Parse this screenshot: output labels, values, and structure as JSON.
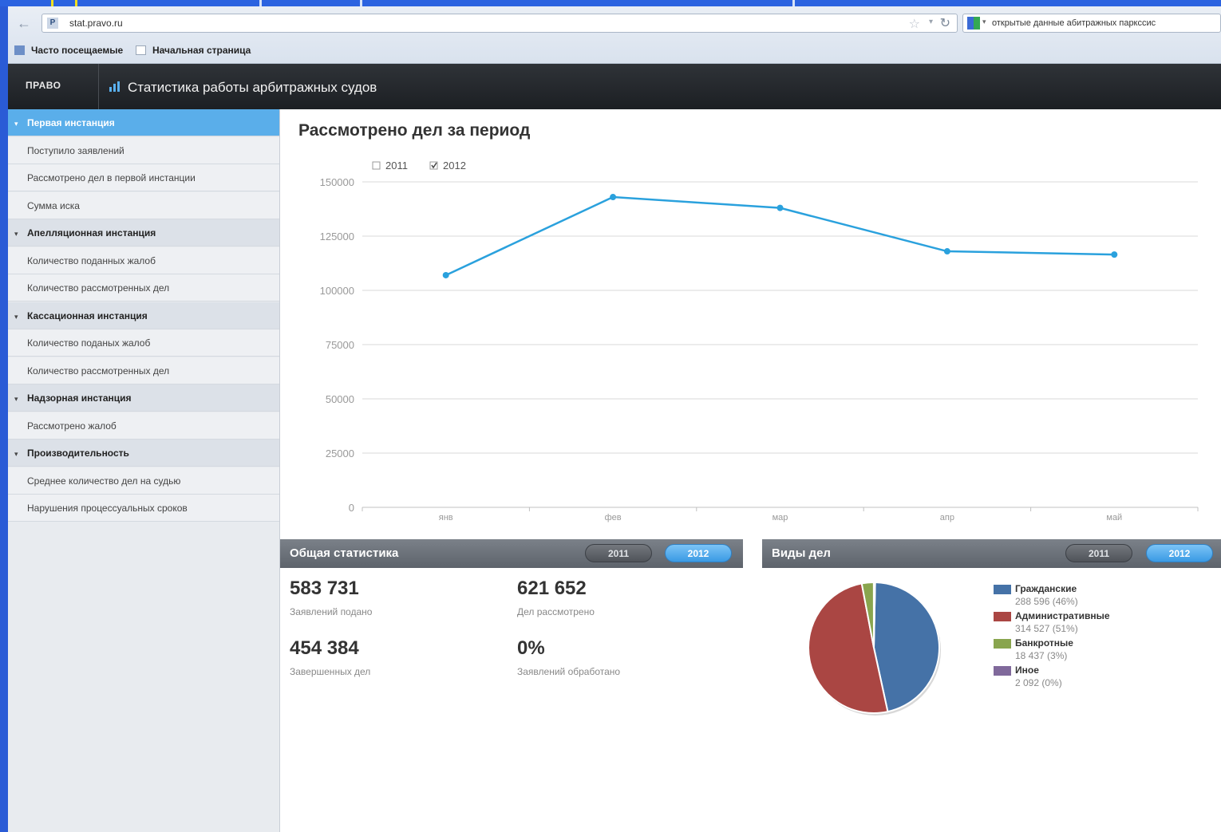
{
  "browser": {
    "url": "stat.pravo.ru",
    "search_text": "открытые данные абитражных паркссис",
    "bookmarks": [
      "Часто посещаемые",
      "Начальная страница"
    ]
  },
  "app": {
    "logo_text": "ПРАВО",
    "title": "Статистика работы арбитражных судов"
  },
  "sidebar": {
    "items": [
      {
        "label": "Первая инстанция",
        "type": "head",
        "active": true
      },
      {
        "label": "Поступило заявлений",
        "type": "sub"
      },
      {
        "label": "Рассмотрено дел в первой инстанции",
        "type": "sub"
      },
      {
        "label": "Сумма иска",
        "type": "sub"
      },
      {
        "label": "Апелляционная инстанция",
        "type": "head"
      },
      {
        "label": "Количество поданных жалоб",
        "type": "sub"
      },
      {
        "label": "Количество рассмотренных дел",
        "type": "sub"
      },
      {
        "label": "Кассационная инстанция",
        "type": "head"
      },
      {
        "label": "Количество поданых жалоб",
        "type": "sub"
      },
      {
        "label": "Количество рассмотренных дел",
        "type": "sub"
      },
      {
        "label": "Надзорная инстанция",
        "type": "head"
      },
      {
        "label": "Рассмотрено жалоб",
        "type": "sub"
      },
      {
        "label": "Производительность",
        "type": "head"
      },
      {
        "label": "Среднее количество дел на судью",
        "type": "sub"
      },
      {
        "label": "Нарушения процессуальных сроков",
        "type": "sub"
      }
    ]
  },
  "main": {
    "chart_title": "Рассмотрено дел за период"
  },
  "chart_data": {
    "type": "line",
    "title": "Рассмотрено дел за период",
    "xlabel": "",
    "ylabel": "",
    "categories": [
      "янв",
      "фев",
      "мар",
      "апр",
      "май"
    ],
    "legend": [
      {
        "label": "2011",
        "checked": false
      },
      {
        "label": "2012",
        "checked": true
      }
    ],
    "series": [
      {
        "name": "2012",
        "values": [
          107000,
          143000,
          138000,
          118000,
          116500
        ]
      }
    ],
    "ylim": [
      0,
      150000
    ],
    "yticks": [
      0,
      25000,
      50000,
      75000,
      100000,
      125000,
      150000
    ],
    "grid": true,
    "line_color": "#2aa1dd"
  },
  "general_stats": {
    "title": "Общая статистика",
    "years": [
      "2011",
      "2012"
    ],
    "active_year": "2012",
    "items": [
      {
        "value": "583 731",
        "label": "Заявлений подано"
      },
      {
        "value": "621 652",
        "label": "Дел рассмотрено"
      },
      {
        "value": "454 384",
        "label": "Завершенных дел"
      },
      {
        "value": "0%",
        "label": "Заявлений обработано"
      }
    ]
  },
  "case_types": {
    "title": "Виды дел",
    "years": [
      "2011",
      "2012"
    ],
    "active_year": "2012",
    "legend": [
      {
        "name": "Гражданские",
        "value_text": "288 596 (46%)",
        "value": 288596,
        "color": "#4572a7"
      },
      {
        "name": "Административные",
        "value_text": "314 527 (51%)",
        "value": 314527,
        "color": "#aa4643"
      },
      {
        "name": "Банкротные",
        "value_text": "18 437 (3%)",
        "value": 18437,
        "color": "#89a54e"
      },
      {
        "name": "Иное",
        "value_text": "2 092 (0%)",
        "value": 2092,
        "color": "#80699b"
      }
    ]
  }
}
